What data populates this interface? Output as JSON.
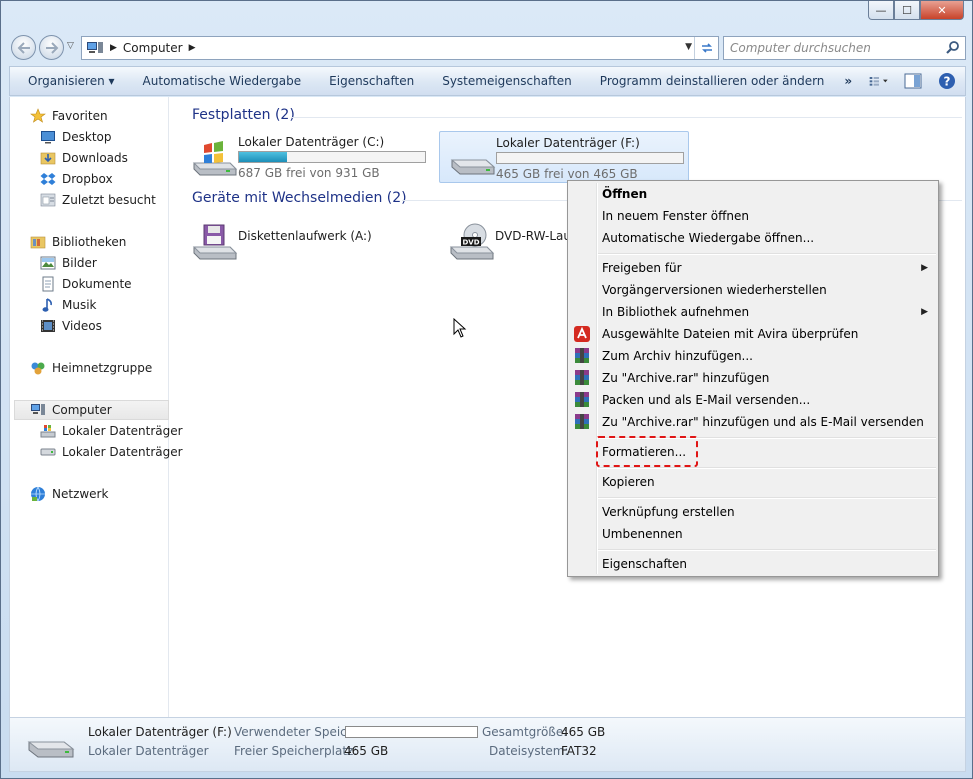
{
  "window": {
    "caption_buttons": {
      "minimize": "—",
      "maximize": "☐",
      "close": "✕"
    }
  },
  "address": {
    "path": [
      "Computer"
    ],
    "search_placeholder": "Computer durchsuchen"
  },
  "toolbar": {
    "items": [
      "Organisieren ▾",
      "Automatische Wiedergabe",
      "Eigenschaften",
      "Systemeigenschaften",
      "Programm deinstallieren oder ändern"
    ],
    "more": "»"
  },
  "nav": {
    "favorites": "Favoriten",
    "desktop": "Desktop",
    "downloads": "Downloads",
    "dropbox": "Dropbox",
    "recent": "Zuletzt besucht",
    "libraries": "Bibliotheken",
    "pictures": "Bilder",
    "documents": "Dokumente",
    "music": "Musik",
    "videos": "Videos",
    "homegroup": "Heimnetzgruppe",
    "computer": "Computer",
    "drive_c": "Lokaler Datenträger",
    "drive_f": "Lokaler Datenträger",
    "network": "Netzwerk"
  },
  "groups": {
    "hard_disks": "Festplatten (2)",
    "removable": "Geräte mit Wechselmedien (2)"
  },
  "drives": {
    "c": {
      "name": "Lokaler Datenträger (C:)",
      "free": "687 GB frei von 931 GB",
      "used_fraction": 0.26
    },
    "f": {
      "name": "Lokaler Datenträger (F:)",
      "free": "465 GB frei von 465 GB",
      "used_fraction": 0.0
    },
    "a": {
      "name": "Diskettenlaufwerk (A:)"
    },
    "dvd": {
      "name": "DVD-RW-Lauf"
    }
  },
  "context_menu": {
    "open": "Öffnen",
    "open_new_window": "In neuem Fenster öffnen",
    "autoplay": "Automatische Wiedergabe öffnen...",
    "share": "Freigeben für",
    "restore": "Vorgängerversionen wiederherstellen",
    "library": "In Bibliothek aufnehmen",
    "avira": "Ausgewählte Dateien mit Avira überprüfen",
    "add_archive": "Zum Archiv hinzufügen...",
    "add_rar": "Zu \"Archive.rar\" hinzufügen",
    "pack_email": "Packen und als E-Mail versenden...",
    "add_rar_email": "Zu \"Archive.rar\" hinzufügen und als E-Mail versenden",
    "format": "Formatieren...",
    "copy": "Kopieren",
    "shortcut": "Verknüpfung erstellen",
    "rename": "Umbenennen",
    "properties": "Eigenschaften"
  },
  "details": {
    "name": "Lokaler Datenträger (F:)",
    "type": "Lokaler Datenträger",
    "used_label": "Verwendeter Speic...",
    "free_label": "Freier Speicherplatz:",
    "free_value": "465 GB",
    "total_label": "Gesamtgröße:",
    "total_value": "465 GB",
    "fs_label": "Dateisystem:",
    "fs_value": "FAT32"
  },
  "colors": {
    "accent": "#1e3287",
    "highlight": "#e01515",
    "bar_fill": "#1d8fb8"
  }
}
